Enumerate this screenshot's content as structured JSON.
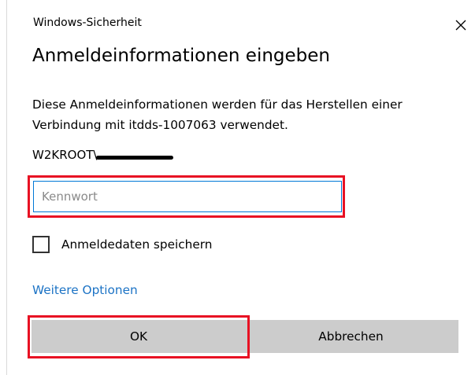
{
  "window": {
    "title": "Windows-Sicherheit",
    "close_icon": "close-icon"
  },
  "dialog": {
    "heading": "Anmeldeinformationen eingeben",
    "description": "Diese Anmeldeinformationen werden für das Herstellen einer Verbindung mit itdds-1007063 verwendet.",
    "username_prefix": "W2KROOT\\"
  },
  "password": {
    "value": "",
    "placeholder": "Kennwort"
  },
  "remember": {
    "label": "Anmeldedaten speichern",
    "checked": false
  },
  "more_options_label": "Weitere Optionen",
  "buttons": {
    "ok_label": "OK",
    "cancel_label": "Abbrechen"
  },
  "colors": {
    "highlight": "#e81123",
    "link": "#1c73c5",
    "input_border": "#0078d7",
    "button_bg": "#cccccc"
  }
}
